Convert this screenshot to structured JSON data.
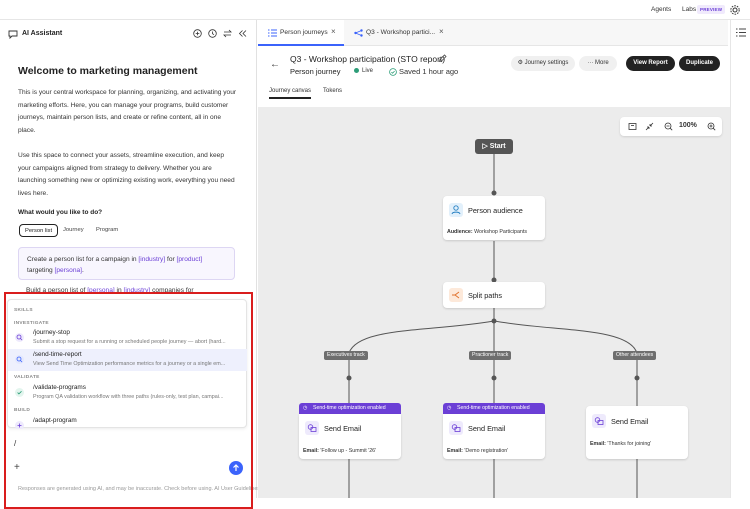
{
  "topbar": {
    "agents": "Agents",
    "labs": "Labs",
    "preview_badge": "PREVIEW"
  },
  "assistant": {
    "title": "AI Assistant",
    "welcome_title": "Welcome to marketing management",
    "intro": "This is your central workspace for planning, organizing, and activating your marketing efforts. Here, you can manage your programs, build customer journeys, maintain person lists, and create or refine content, all in one place.",
    "intro2": "Use this space to connect your assets, streamline execution, and keep your campaigns aligned from strategy to delivery. Whether you are launching something new or optimizing existing work, everything you need lives here.",
    "question": "What would you like to do?",
    "chips": [
      "Person list",
      "Journey",
      "Program"
    ],
    "suggestion": {
      "pre": "Create a person list for a campaign in ",
      "v1": "[industry]",
      "mid": " for ",
      "v2": "[product]",
      "pre2": "targeting ",
      "v3": "[persona]",
      "end": "."
    },
    "suggestion2": {
      "pre": "Build a person list of ",
      "v1": "[persona]",
      "mid": " in ",
      "v2": "[industry]",
      "post": " companies for"
    },
    "skills": {
      "heading": "SKILLS",
      "sections": {
        "investigate": "INVESTIGATE",
        "validate": "VALIDATE",
        "build": "BUILD"
      },
      "items": [
        {
          "cmd": "/journey-stop",
          "desc": "Submit a stop request for a running or scheduled people journey — abort (hard..."
        },
        {
          "cmd": "/send-time-report",
          "desc": "View Send Time Optimization performance metrics for a journey or a single em..."
        },
        {
          "cmd": "/validate-programs",
          "desc": "Program QA validation workflow with three paths (rules-only, test plan, campai..."
        },
        {
          "cmd": "/adapt-program",
          "desc": "..."
        }
      ]
    },
    "input_value": "/",
    "disclaimer": "Responses are generated using AI, and may be inaccurate. Check before using. AI User Guidelines"
  },
  "tabs": [
    {
      "label": "Person journeys",
      "active": true
    },
    {
      "label": "Q3 - Workshop partici...",
      "active": false
    }
  ],
  "journey": {
    "title": "Q3 - Workshop participation (STO report)",
    "type": "Person journey",
    "status": "Live",
    "saved": "Saved 1 hour ago",
    "settings_label": "Journey settings",
    "more_label": "More",
    "view_report": "View Report",
    "duplicate": "Duplicate",
    "subtabs": [
      "Journey canvas",
      "Tokens"
    ]
  },
  "canvas": {
    "zoom": "100%",
    "start": "Start",
    "audience_node": {
      "label": "Person audience",
      "meta_key": "Audience:",
      "meta_val": "Workshop Participants"
    },
    "split_node": {
      "label": "Split paths"
    },
    "tracks": [
      "Executives track",
      "Practioner track",
      "Other attendees"
    ],
    "sto_badge": "Send-time optimization enabled",
    "email_nodes": [
      {
        "label": "Send Email",
        "meta_key": "Email:",
        "meta_val": "'Follow up - Summit '26'"
      },
      {
        "label": "Send Email",
        "meta_key": "Email:",
        "meta_val": "'Demo registration'"
      },
      {
        "label": "Send Email",
        "meta_key": "Email:",
        "meta_val": "'Thanks for joining'"
      }
    ]
  },
  "colors": {
    "accent": "#3b63fb",
    "purple": "#6b3fd6",
    "live": "#2d9d78",
    "alert": "#d91d1d"
  }
}
